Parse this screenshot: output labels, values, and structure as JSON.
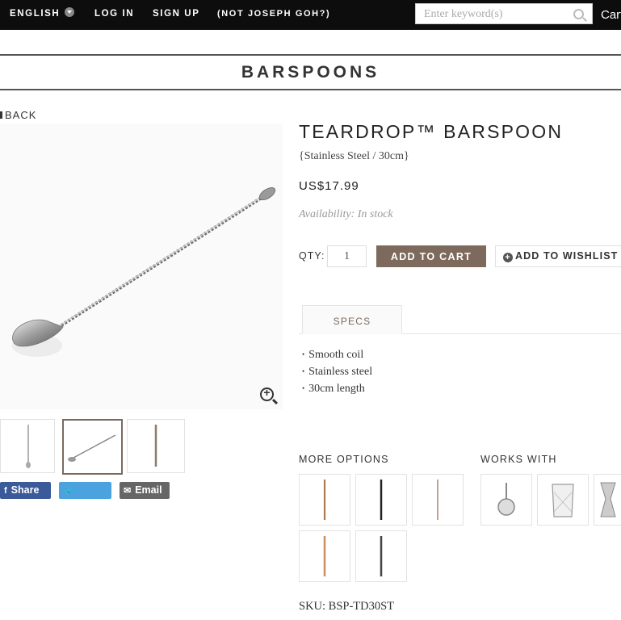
{
  "topbar": {
    "language": "ENGLISH",
    "login": "LOG IN",
    "signup": "SIGN UP",
    "not_user": "(NOT JOSEPH GOH?)",
    "search_placeholder": "Enter keyword(s)",
    "cart": "Cart"
  },
  "category_title": "BARSPOONS",
  "back_label": "BACK",
  "product": {
    "title": "TEARDROP™ BARSPOON",
    "variant": "{Stainless Steel / 30cm}",
    "price": "US$17.99",
    "availability": "Availability: In stock",
    "qty_label": "QTY:",
    "qty_value": "1",
    "add_to_cart": "ADD TO CART",
    "add_to_wishlist": "ADD TO WISHLIST"
  },
  "share": {
    "facebook": "Share",
    "twitter": "Tweet",
    "email": "Email"
  },
  "tabs": {
    "specs": "SPECS"
  },
  "specs": [
    "Smooth coil",
    "Stainless steel",
    "30cm length"
  ],
  "more_options_label": "MORE OPTIONS",
  "works_with_label": "WORKS WITH",
  "sku": "SKU: BSP-TD30ST",
  "colors": {
    "accent": "#7d6a5d",
    "topbar": "#0d0d0d",
    "facebook": "#3b5a9a",
    "twitter": "#4aa3df",
    "email": "#666666"
  }
}
